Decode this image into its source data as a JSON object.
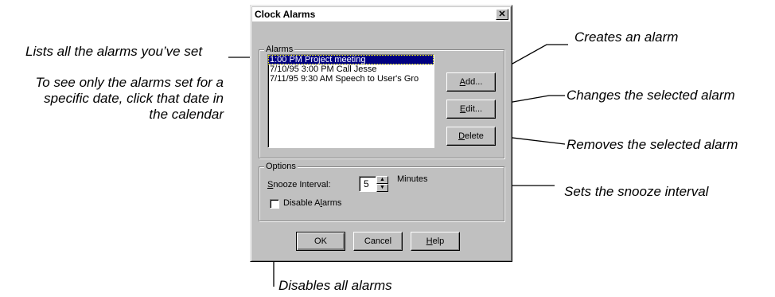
{
  "dialog": {
    "title": "Clock Alarms",
    "close_glyph": "✕",
    "alarms_group": {
      "legend": "Alarms",
      "items": [
        {
          "label": "1:00 PM Project meeting",
          "selected": true
        },
        {
          "label": "7/10/95 3:00 PM Call Jesse",
          "selected": false
        },
        {
          "label": "7/11/95 9:30 AM Speech to User's Gro",
          "selected": false
        }
      ]
    },
    "buttons": {
      "add": {
        "pre": "",
        "key": "A",
        "post": "dd..."
      },
      "edit": {
        "pre": "",
        "key": "E",
        "post": "dit..."
      },
      "delete": {
        "pre": "",
        "key": "D",
        "post": "elete"
      },
      "ok": "OK",
      "cancel": "Cancel",
      "help": {
        "pre": "",
        "key": "H",
        "post": "elp"
      }
    },
    "options_group": {
      "legend": "Options",
      "snooze_label": {
        "pre": "",
        "key": "S",
        "post": "nooze Interval:"
      },
      "snooze_value": "5",
      "snooze_unit": "Minutes",
      "disable_label": {
        "pre": "Disable A",
        "key": "l",
        "post": "arms"
      },
      "disable_checked": false
    }
  },
  "callouts": {
    "lists_all": "Lists all the alarms you’ve set",
    "see_only_line1": "To see only the alarms set for a",
    "see_only_line2": "specific date, click that date in",
    "see_only_line3": "the calendar",
    "creates": "Creates an alarm",
    "changes": "Changes the selected alarm",
    "removes": "Removes the selected alarm",
    "snooze": "Sets the snooze interval",
    "disables": "Disables all alarms"
  },
  "icons": {
    "spin_up": "▲",
    "spin_down": "▼"
  }
}
